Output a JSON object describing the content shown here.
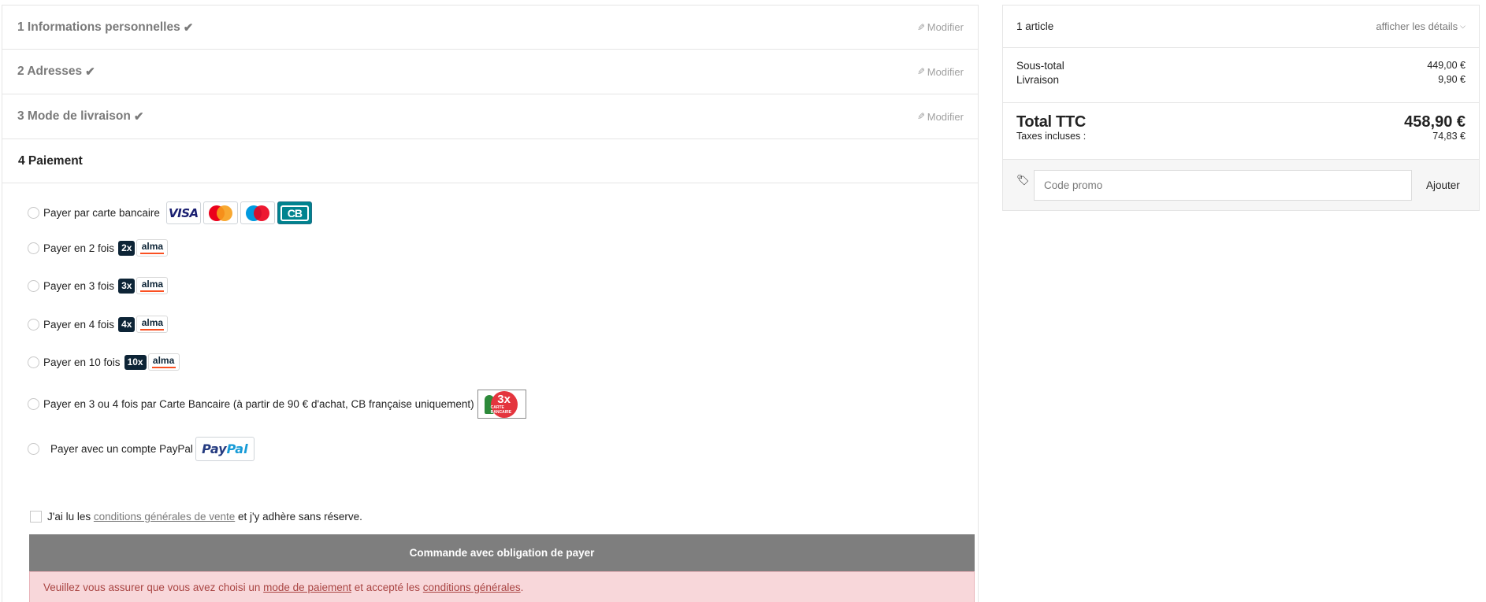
{
  "steps": [
    {
      "label": "1 Informations personnelles",
      "modify": "Modifier"
    },
    {
      "label": "2 Adresses",
      "modify": "Modifier"
    },
    {
      "label": "3 Mode de livraison",
      "modify": "Modifier"
    }
  ],
  "payment": {
    "title": "4 Paiement",
    "options": [
      {
        "label": "Payer par carte bancaire",
        "logos": [
          "visa-icon",
          "mastercard-icon",
          "maestro-icon",
          "cb-icon"
        ]
      },
      {
        "label": "Payer en 2 fois",
        "badge": "2x",
        "brand": "alma"
      },
      {
        "label": "Payer en 3 fois",
        "badge": "3x",
        "brand": "alma"
      },
      {
        "label": "Payer en 4 fois",
        "badge": "4x",
        "brand": "alma"
      },
      {
        "label": "Payer en 10 fois",
        "badge": "10x",
        "brand": "alma"
      },
      {
        "label": "Payer en 3 ou 4 fois par Carte Bancaire (à partir de 90 € d'achat, CB française uniquement)",
        "logo_text": "3x",
        "logo_sub": "CARTE BANCAIRE"
      },
      {
        "label": "Payer avec un compte PayPal",
        "logo_text_1": "Pay",
        "logo_text_2": "Pal"
      }
    ],
    "terms": {
      "prefix": "J'ai lu les ",
      "link": "conditions générales de vente",
      "suffix": " et j'y adhère sans réserve."
    },
    "order_button": "Commande avec obligation de payer",
    "warning": {
      "prefix": "Veuillez vous assurer que vous avez choisi un ",
      "link1": "mode de paiement",
      "middle": " et accepté les ",
      "link2": "conditions générales",
      "suffix": "."
    }
  },
  "summary": {
    "count": "1 article",
    "details": "afficher les détails",
    "subtotal_label": "Sous-total",
    "subtotal_value": "449,00 €",
    "shipping_label": "Livraison",
    "shipping_value": "9,90 €",
    "total_label": "Total TTC",
    "total_value": "458,90 €",
    "tax_label": "Taxes incluses :",
    "tax_value": "74,83 €",
    "promo_placeholder": "Code promo",
    "promo_button": "Ajouter"
  },
  "colors": {
    "order_button_bg": "#7e7e7e",
    "warning_bg": "#f8d7da",
    "warning_text": "#a94442",
    "alma_badge": "#0d2436",
    "alma_accent": "#fa5022"
  }
}
